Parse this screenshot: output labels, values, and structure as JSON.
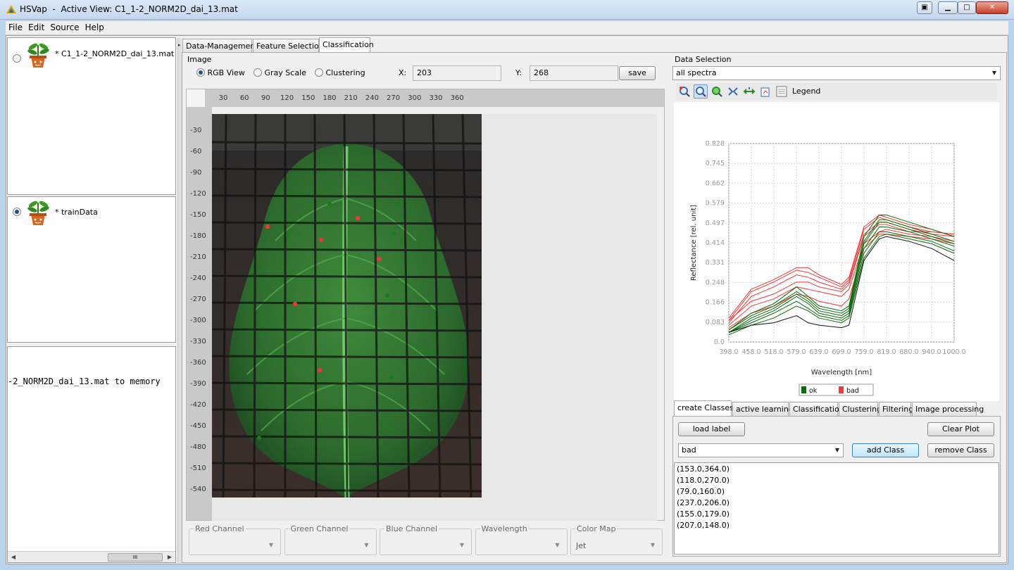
{
  "window": {
    "app_name": "HSVap",
    "title_sep": "  -  ",
    "active_view_label": "Active View:",
    "active_view_file": "C1_1-2_NORM2D_dai_13.mat"
  },
  "menu": [
    "File",
    "Edit",
    "Source",
    "Help"
  ],
  "left": {
    "datasets": [
      {
        "label": "* C1_1-2_NORM2D_dai_13.mat",
        "selected": false
      },
      {
        "label": "* trainData",
        "selected": true
      }
    ],
    "console_text": "-2_NORM2D_dai_13.mat to memory",
    "hscroll_grip": "III"
  },
  "tabs": [
    "Data-Management",
    "Feature Selection",
    "Classification"
  ],
  "image": {
    "section": "Image",
    "modes": [
      "RGB View",
      "Gray Scale",
      "Clustering"
    ],
    "selected_mode": "RGB View",
    "x_label": "X:",
    "x_value": "203",
    "y_label": "Y:",
    "y_value": "268",
    "save_label": "save",
    "x_ticks": [
      "30",
      "60",
      "90",
      "120",
      "150",
      "180",
      "210",
      "240",
      "270",
      "300",
      "330",
      "360"
    ],
    "y_ticks": [
      "-30",
      "-60",
      "-90",
      "-120",
      "-150",
      "-180",
      "-210",
      "-240",
      "-270",
      "-300",
      "-330",
      "-360",
      "-390",
      "-420",
      "-450",
      "-480",
      "-510",
      "-540"
    ]
  },
  "channels": [
    {
      "label": "Red Channel",
      "value": ""
    },
    {
      "label": "Green Channel",
      "value": ""
    },
    {
      "label": "Blue Channel",
      "value": ""
    },
    {
      "label": "Wavelength",
      "value": ""
    },
    {
      "label": "Color Map",
      "value": "Jet"
    }
  ],
  "data_selection": {
    "label": "Data Selection",
    "value": "all spectra",
    "legend_label": "Legend"
  },
  "chart_data": {
    "type": "line",
    "xlabel": "Wavelength [nm]",
    "ylabel": "Reflectance [rel. unit]",
    "x_ticks": [
      "398.0",
      "458.0",
      "518.0",
      "579.0",
      "639.0",
      "699.0",
      "759.0",
      "819.0",
      "880.0",
      "940.0",
      "1000.0"
    ],
    "y_ticks": [
      "0.0",
      "0.083",
      "0.166",
      "0.248",
      "0.331",
      "0.414",
      "0.497",
      "0.579",
      "0.662",
      "0.745",
      "0.828"
    ],
    "xlim": [
      398,
      1000
    ],
    "ylim": [
      0,
      0.828
    ],
    "grid": true,
    "legend_position": "bottom",
    "colors": {
      "ok": "#0b6b0b",
      "bad": "#f03a3a",
      "black": "#111111"
    },
    "legend": [
      {
        "name": "ok",
        "color": "#0b6b0b"
      },
      {
        "name": "bad",
        "color": "#f03a3a"
      }
    ],
    "x": [
      398,
      458,
      518,
      579,
      610,
      639,
      699,
      719,
      759,
      800,
      819,
      880,
      940,
      1000
    ],
    "series": [
      {
        "cls": "bad",
        "values": [
          0.1,
          0.22,
          0.26,
          0.31,
          0.31,
          0.28,
          0.24,
          0.27,
          0.48,
          0.53,
          0.52,
          0.49,
          0.47,
          0.44
        ]
      },
      {
        "cls": "bad",
        "values": [
          0.09,
          0.21,
          0.25,
          0.3,
          0.29,
          0.27,
          0.23,
          0.26,
          0.47,
          0.52,
          0.51,
          0.48,
          0.46,
          0.45
        ]
      },
      {
        "cls": "bad",
        "values": [
          0.08,
          0.19,
          0.23,
          0.28,
          0.27,
          0.25,
          0.22,
          0.25,
          0.45,
          0.5,
          0.5,
          0.47,
          0.45,
          0.44
        ]
      },
      {
        "cls": "bad",
        "values": [
          0.09,
          0.17,
          0.2,
          0.25,
          0.25,
          0.23,
          0.21,
          0.24,
          0.44,
          0.49,
          0.49,
          0.46,
          0.46,
          0.45
        ]
      },
      {
        "cls": "bad",
        "values": [
          0.07,
          0.15,
          0.18,
          0.23,
          0.22,
          0.21,
          0.19,
          0.22,
          0.41,
          0.46,
          0.47,
          0.45,
          0.44,
          0.42
        ]
      },
      {
        "cls": "bad",
        "values": [
          0.06,
          0.12,
          0.15,
          0.2,
          0.19,
          0.17,
          0.15,
          0.18,
          0.39,
          0.45,
          0.45,
          0.44,
          0.43,
          0.41
        ]
      },
      {
        "cls": "ok",
        "values": [
          0.05,
          0.12,
          0.16,
          0.23,
          0.19,
          0.15,
          0.13,
          0.15,
          0.44,
          0.53,
          0.53,
          0.5,
          0.47,
          0.44
        ]
      },
      {
        "cls": "ok",
        "values": [
          0.05,
          0.11,
          0.15,
          0.21,
          0.18,
          0.14,
          0.12,
          0.14,
          0.42,
          0.51,
          0.51,
          0.48,
          0.45,
          0.42
        ]
      },
      {
        "cls": "ok",
        "values": [
          0.04,
          0.1,
          0.14,
          0.2,
          0.17,
          0.13,
          0.11,
          0.13,
          0.41,
          0.5,
          0.5,
          0.47,
          0.44,
          0.41
        ]
      },
      {
        "cls": "ok",
        "values": [
          0.04,
          0.09,
          0.13,
          0.19,
          0.16,
          0.12,
          0.1,
          0.12,
          0.39,
          0.48,
          0.48,
          0.46,
          0.43,
          0.4
        ]
      },
      {
        "cls": "ok",
        "values": [
          0.04,
          0.08,
          0.12,
          0.17,
          0.14,
          0.11,
          0.09,
          0.11,
          0.37,
          0.46,
          0.46,
          0.44,
          0.42,
          0.38
        ]
      },
      {
        "cls": "ok",
        "values": [
          0.03,
          0.07,
          0.1,
          0.15,
          0.13,
          0.1,
          0.08,
          0.1,
          0.35,
          0.44,
          0.45,
          0.43,
          0.41,
          0.37
        ]
      },
      {
        "cls": "black",
        "values": [
          0.04,
          0.07,
          0.08,
          0.11,
          0.08,
          0.07,
          0.06,
          0.07,
          0.34,
          0.43,
          0.44,
          0.42,
          0.39,
          0.34
        ]
      }
    ]
  },
  "bottom_tabs": [
    "create Classes",
    "active learning",
    "Classification",
    "Clustering",
    "Filtering",
    "Image processing"
  ],
  "classes": {
    "load_label": "load label",
    "clear_plot": "Clear Plot",
    "selected_class": "bad",
    "add_class": "add Class",
    "remove_class": "remove Class",
    "points": [
      "(153.0,364.0)",
      "(118.0,270.0)",
      "(79.0,160.0)",
      "(237.0,206.0)",
      "(155.0,179.0)",
      "(207.0,148.0)"
    ]
  },
  "markers": {
    "red": [
      [
        79,
        160
      ],
      [
        155,
        179
      ],
      [
        207,
        148
      ],
      [
        237,
        206
      ],
      [
        118,
        270
      ],
      [
        153,
        364
      ]
    ],
    "green": [
      [
        167,
        128
      ],
      [
        264,
        128
      ],
      [
        108,
        172
      ],
      [
        258,
        170
      ],
      [
        249,
        258
      ],
      [
        308,
        340
      ],
      [
        255,
        374
      ],
      [
        255,
        446
      ],
      [
        67,
        460
      ]
    ]
  }
}
